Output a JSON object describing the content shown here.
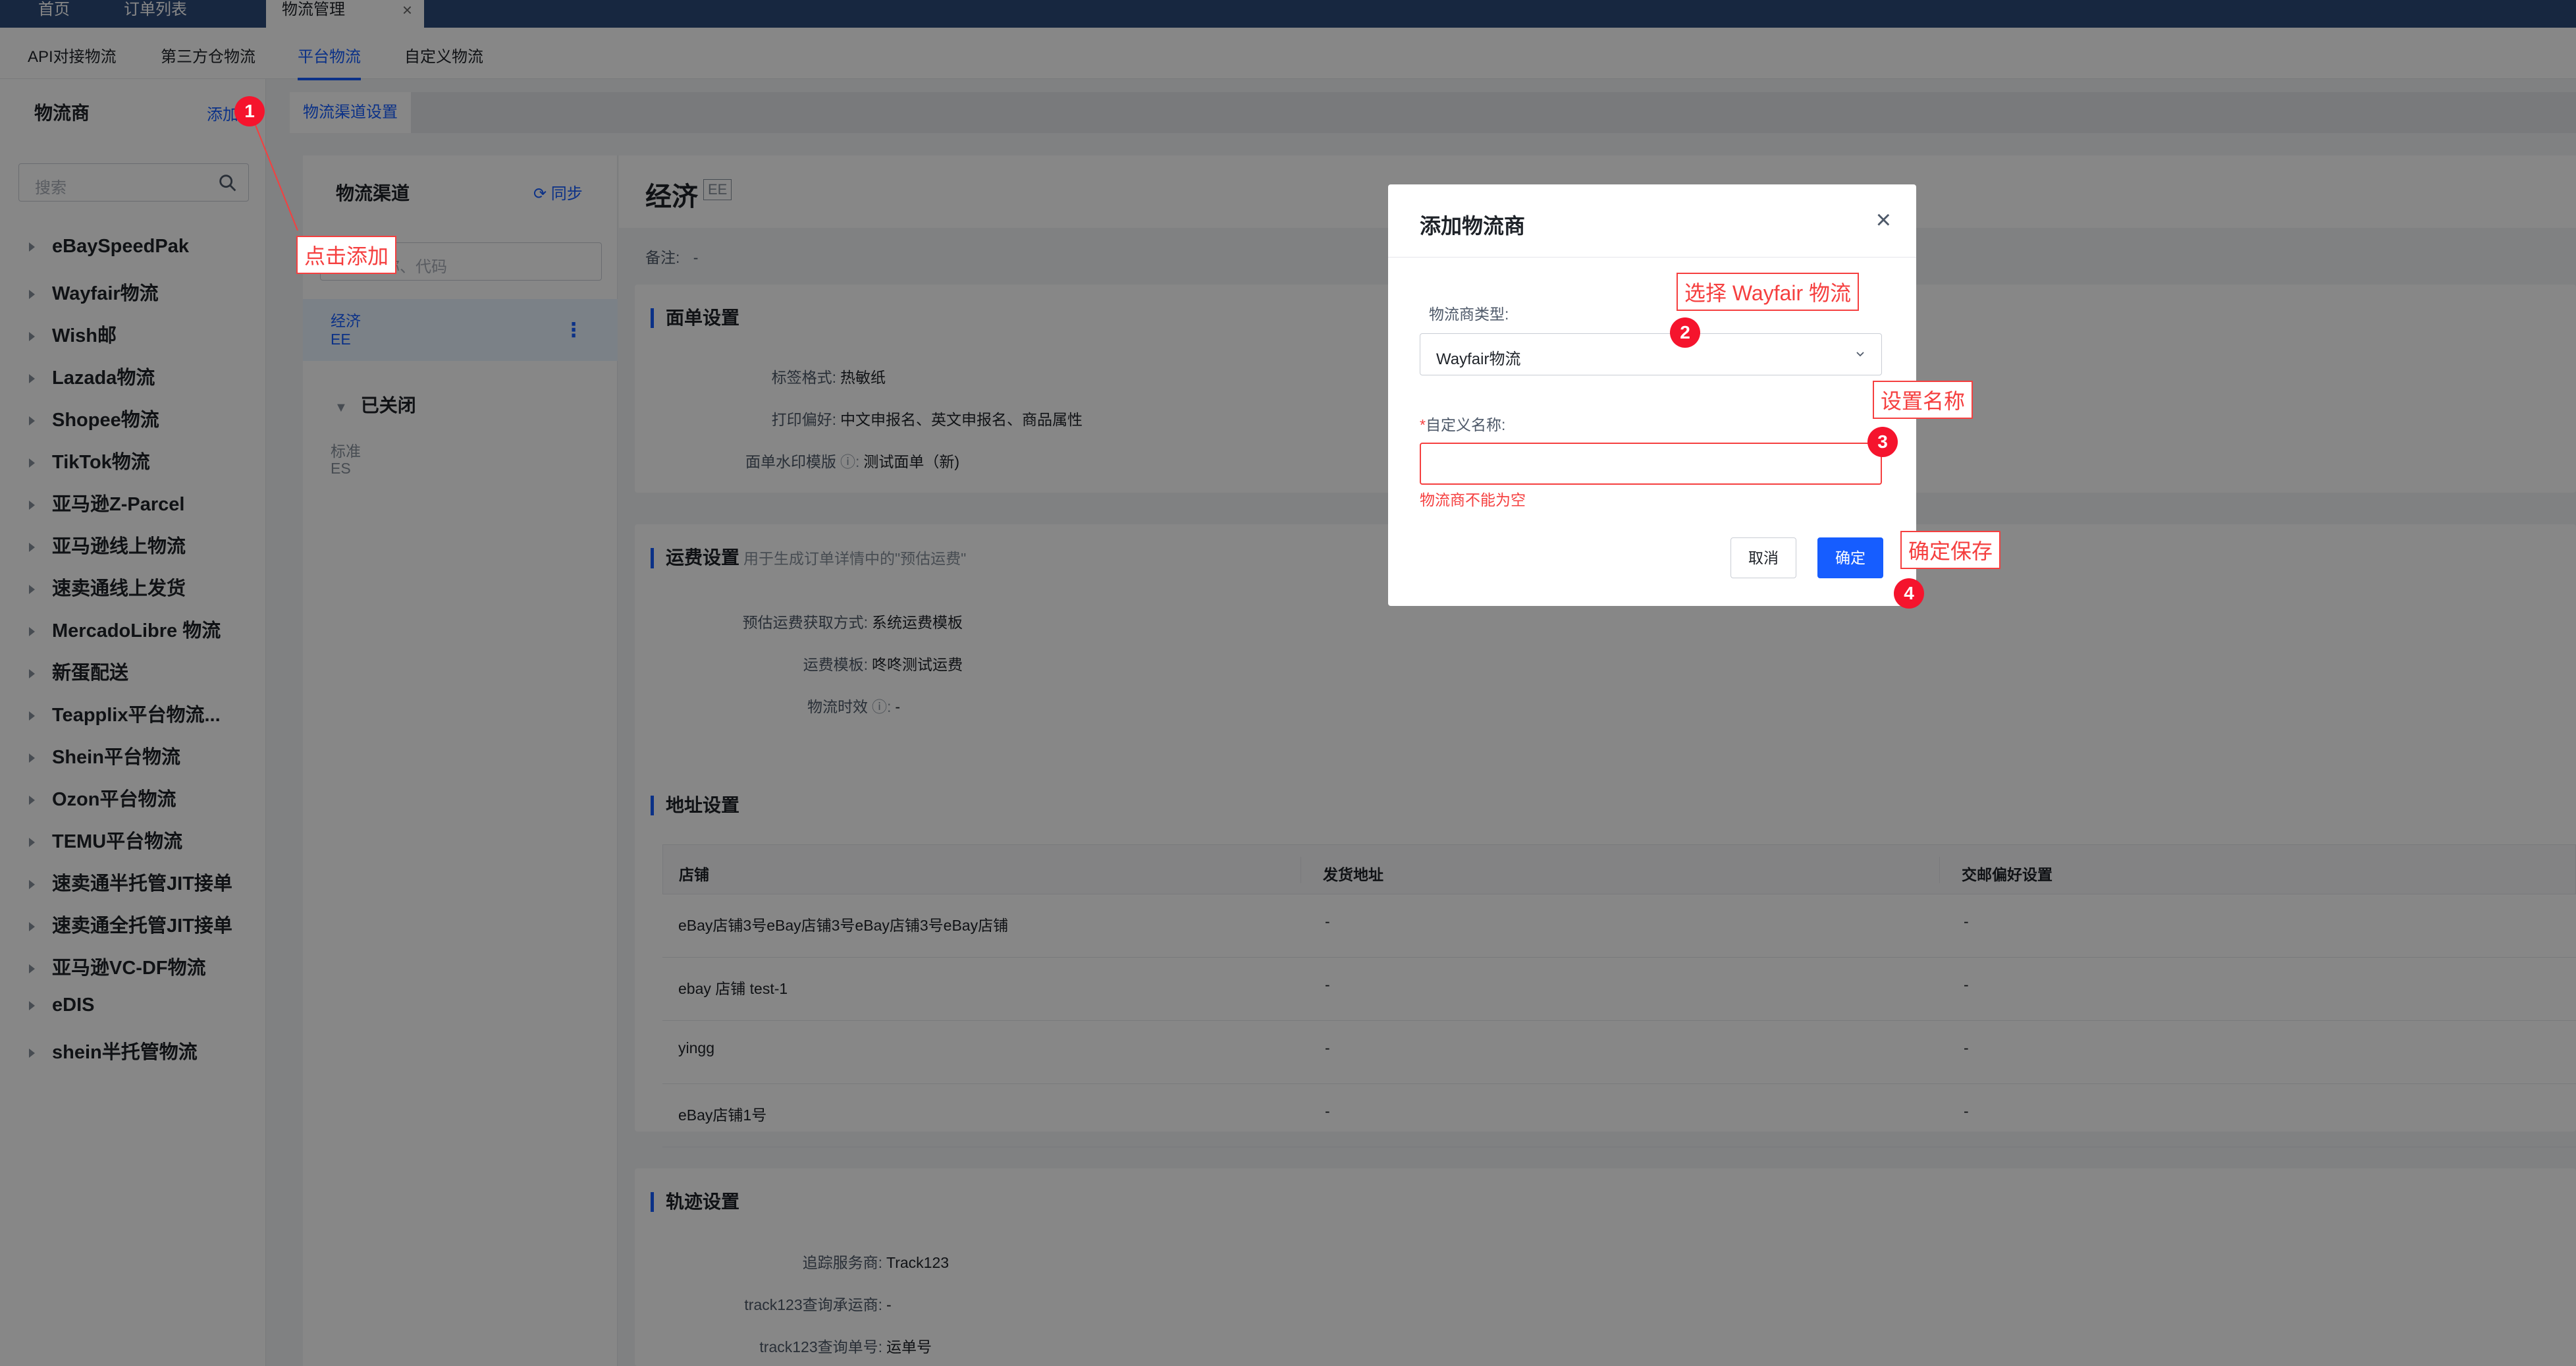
{
  "topbar": {
    "tabs": [
      "首页",
      "订单列表",
      "物流管理"
    ],
    "active_tab": "物流管理",
    "close_glyph": "×"
  },
  "subnav": {
    "items": [
      "API对接物流",
      "第三方仓物流",
      "平台物流",
      "自定义物流"
    ],
    "active": "平台物流"
  },
  "sidebar": {
    "title": "物流商",
    "add_label": "添加",
    "search_placeholder": "搜索",
    "carriers": [
      "eBaySpeedPak",
      "Wayfair物流",
      "Wish邮",
      "Lazada物流",
      "Shopee物流",
      "TikTok物流",
      "亚马逊Z-Parcel",
      "亚马逊线上物流",
      "速卖通线上发货",
      "MercadoLibre 物流",
      "新蛋配送",
      "Teapplix平台物流...",
      "Shein平台物流",
      "Ozon平台物流",
      "TEMU平台物流",
      "速卖通半托管JIT接单",
      "速卖通全托管JIT接单",
      "亚马逊VC-DF物流",
      "eDIS",
      "shein半托管物流"
    ]
  },
  "midtabs": {
    "active": "物流渠道设置"
  },
  "channels": {
    "title": "物流渠道",
    "sync_label": "同步",
    "search_placeholder": "搜索名称、代码",
    "selected": {
      "name": "经济",
      "code": "EE"
    },
    "closed_group": "已关闭",
    "closed_items": [
      {
        "name": "标准",
        "code": "ES"
      }
    ]
  },
  "detail": {
    "name": "经济",
    "code": "EE",
    "note_label": "备注:",
    "note_value": "-",
    "label_section": {
      "title": "面单设置",
      "rows": [
        {
          "k": "标签格式:",
          "v": "热敏纸"
        },
        {
          "k": "打印偏好:",
          "v": "中文申报名、英文申报名、商品属性"
        },
        {
          "k": "面单水印模版",
          "v": "测试面单（新)"
        }
      ]
    },
    "freight_section": {
      "title": "运费设置",
      "subtitle": "用于生成订单详情中的\"预估运费\"",
      "rows": [
        {
          "k": "预估运费获取方式:",
          "v": "系统运费模板"
        },
        {
          "k": "运费模板:",
          "v": "咚咚测试运费"
        },
        {
          "k": "物流时效",
          "v": "-"
        }
      ]
    },
    "address_section": {
      "title": "地址设置",
      "headers": [
        "店铺",
        "发货地址",
        "交邮偏好设置"
      ],
      "rows": [
        [
          "eBay店铺3号eBay店铺3号eBay店铺3号eBay店铺",
          "-",
          "-"
        ],
        [
          "ebay 店铺 test-1",
          "-",
          "-"
        ],
        [
          "yingg",
          "-",
          "-"
        ],
        [
          "eBay店铺1号",
          "-",
          "-"
        ]
      ]
    },
    "track_section": {
      "title": "轨迹设置",
      "rows": [
        {
          "k": "追踪服务商:",
          "v": "Track123"
        },
        {
          "k": "track123查询承运商:",
          "v": "-"
        },
        {
          "k": "track123查询单号:",
          "v": "运单号"
        }
      ]
    }
  },
  "modal": {
    "title": "添加物流商",
    "type_label": "物流商类型:",
    "type_value": "Wayfair物流",
    "name_label": "自定义名称:",
    "name_value": "",
    "error_text": "物流商不能为空",
    "cancel_label": "取消",
    "ok_label": "确定"
  },
  "annotations": {
    "step1": {
      "num": "1",
      "text": "点击添加"
    },
    "step2": {
      "num": "2",
      "text": "选择 Wayfair 物流"
    },
    "step3": {
      "num": "3",
      "text": "设置名称"
    },
    "step4": {
      "num": "4",
      "text": "确定保存"
    }
  },
  "colors": {
    "primary": "#165dff",
    "error": "#f53f3f",
    "topbar": "#2d4a7a",
    "annotation": "#f5142d"
  }
}
